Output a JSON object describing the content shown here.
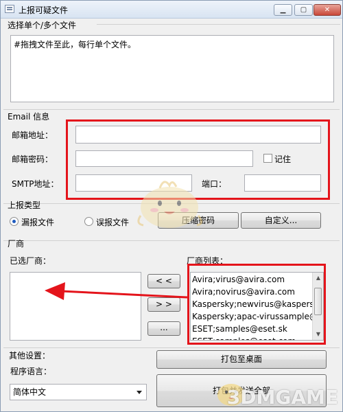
{
  "window": {
    "title": "上报可疑文件"
  },
  "titlebar": {
    "minimize": "▁",
    "maximize": "▢",
    "close": "✕"
  },
  "files": {
    "group_label": "选择单个/多个文件",
    "drop_text": "#拖拽文件至此，每行单个文件。"
  },
  "email": {
    "group_label": "Email 信息",
    "address_label": "邮箱地址：",
    "password_label": "邮箱密码：",
    "remember_label": "记住",
    "smtp_label": "SMTP地址：",
    "port_label": "端口："
  },
  "report_type": {
    "group_label": "上报类型",
    "missed_label": "漏报文件",
    "false_label": "误报文件",
    "compress_password_button": "压缩密码",
    "custom_button": "自定义..."
  },
  "vendors": {
    "group_label": "厂商",
    "selected_label": "已选厂商：",
    "list_label": "厂商列表：",
    "add_button": "< <",
    "remove_button": "> >",
    "more_button": "...",
    "list_items": [
      "Avira;virus@avira.com",
      "Avira;novirus@avira.com",
      "Kaspersky;newvirus@kaspersky.com",
      "Kaspersky;apac-virussample@kaspersky.com",
      "ESET;samples@eset.sk",
      "ESET;samples@eset.com"
    ]
  },
  "other": {
    "group_label": "其他设置：",
    "language_label": "程序语言：",
    "language_value": "简体中文",
    "pack_button": "打包至桌面",
    "send_all_button": "打包并发送全部"
  },
  "watermark": {
    "text": "3DMGAME"
  },
  "colors": {
    "annotation": "#e4141b",
    "accent": "#1e5bbf"
  }
}
